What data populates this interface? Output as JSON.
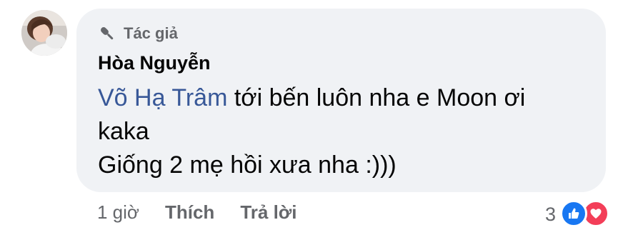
{
  "comment": {
    "author_badge": "Tác giả",
    "author_name": "Hòa Nguyễn",
    "mention": "Võ Hạ Trâm",
    "text_line1_rest": " tới bến luôn nha e Moon ơi",
    "text_line2": "kaka",
    "text_line3": "Giống 2 mẹ hồi xưa nha :)))"
  },
  "actions": {
    "time": "1 giờ",
    "like_label": "Thích",
    "reply_label": "Trả lời"
  },
  "reactions": {
    "count": "3",
    "types": [
      "like-icon",
      "love-icon"
    ]
  },
  "colors": {
    "bubble": "#f0f2f5",
    "mention": "#385898",
    "secondary_text": "#65676b",
    "like": "#1877f2",
    "love": "#f33e58"
  },
  "icons": {
    "badge": "microphone-icon",
    "avatar": "profile-photo"
  }
}
